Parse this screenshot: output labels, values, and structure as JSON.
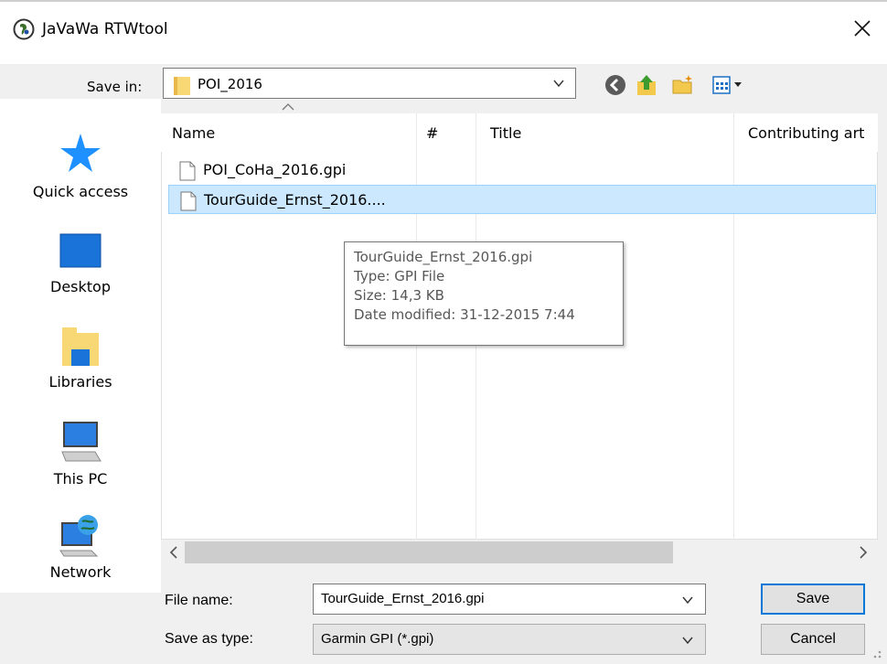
{
  "window": {
    "title": "JaVaWa RTWtool"
  },
  "save_in": {
    "label": "Save in:",
    "value": "POI_2016"
  },
  "places": [
    {
      "label": "Quick access",
      "icon": "star-icon"
    },
    {
      "label": "Desktop",
      "icon": "desktop-icon"
    },
    {
      "label": "Libraries",
      "icon": "libraries-icon"
    },
    {
      "label": "This PC",
      "icon": "computer-icon"
    },
    {
      "label": "Network",
      "icon": "network-icon"
    }
  ],
  "columns": [
    "Name",
    "#",
    "Title",
    "Contributing art"
  ],
  "files": [
    {
      "name": "POI_CoHa_2016.gpi"
    },
    {
      "name": "TourGuide_Ernst_2016...."
    }
  ],
  "tooltip": {
    "line1": "TourGuide_Ernst_2016.gpi",
    "line2": "Type: GPI File",
    "line3": "Size: 14,3 KB",
    "line4": "Date modified: 31-12-2015 7:44"
  },
  "file_name": {
    "label": "File name:",
    "value": "TourGuide_Ernst_2016.gpi"
  },
  "save_as_type": {
    "label": "Save as type:",
    "value": "Garmin GPI (*.gpi)"
  },
  "buttons": {
    "save": "Save",
    "cancel": "Cancel"
  },
  "colors": {
    "selection": "#cce8ff",
    "accent": "#0078d7"
  }
}
